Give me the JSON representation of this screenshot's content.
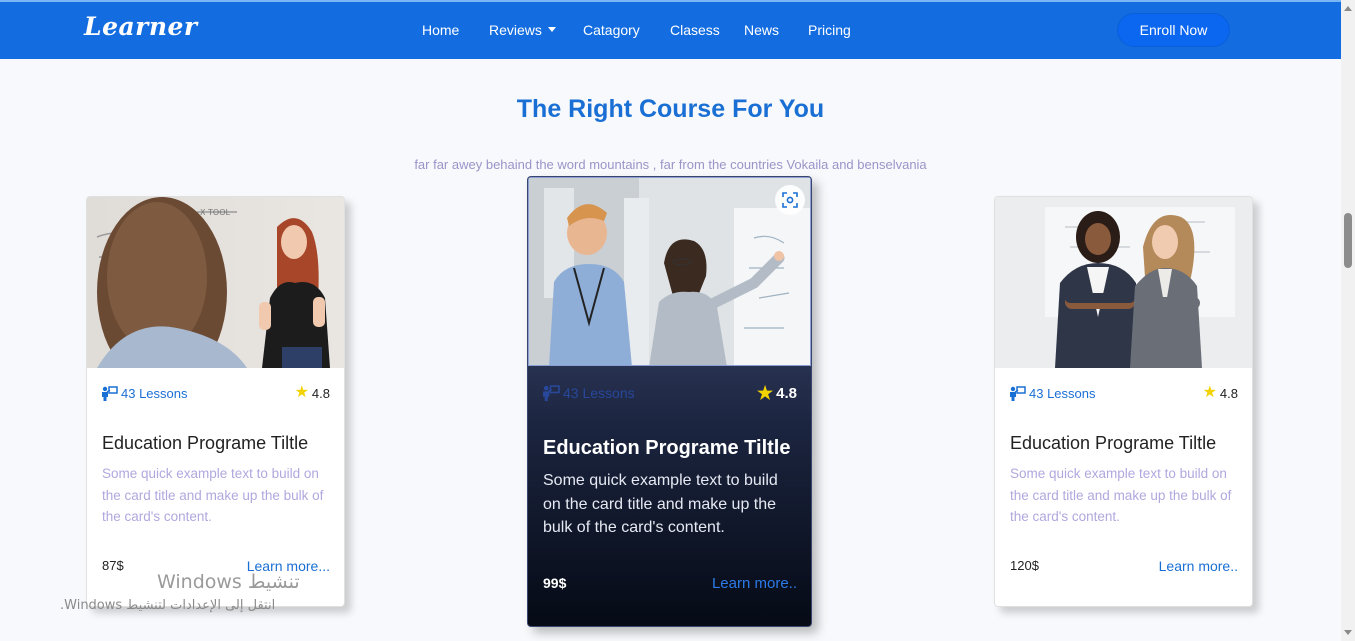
{
  "navbar": {
    "brand": "Learner",
    "links": [
      {
        "label": "Home"
      },
      {
        "label": "Reviews"
      },
      {
        "label": "Catagory"
      },
      {
        "label": "Clasess"
      },
      {
        "label": "News"
      },
      {
        "label": "Pricing"
      }
    ],
    "cta": "Enroll Now",
    "bg_color": "#136de0"
  },
  "section": {
    "title": "The Right Course For You",
    "subtitle": "far far awey behaind the word mountains , far from the countries Vokaila and benselvania"
  },
  "cards": [
    {
      "lessons": "43 Lessons",
      "rating": "4.8",
      "title": "Education Programe Tiltle",
      "text": "Some quick example text to build on the card title and make up the bulk of the card's content.",
      "price": "87$",
      "link": "Learn more..."
    },
    {
      "lessons": "43 Lessons",
      "rating": "4.8",
      "title": "Education Programe Tiltle",
      "text": "Some quick example text to build on the card title and make up the bulk of the card's content.",
      "price": "99$",
      "link": "Learn more.."
    },
    {
      "lessons": "43 Lessons",
      "rating": "4.8",
      "title": "Education Programe Tiltle",
      "text": "Some quick example text to build on the card title and make up the bulk of the card's content.",
      "price": "120$",
      "link": "Learn more.."
    }
  ],
  "watermark": {
    "line1": "تنشيط Windows",
    "line2": "انتقل إلى الإعدادات لتنشيط Windows."
  },
  "colors": {
    "accent": "#1a6fd4",
    "subtitle": "#9b94c8",
    "star": "#f2d200"
  }
}
